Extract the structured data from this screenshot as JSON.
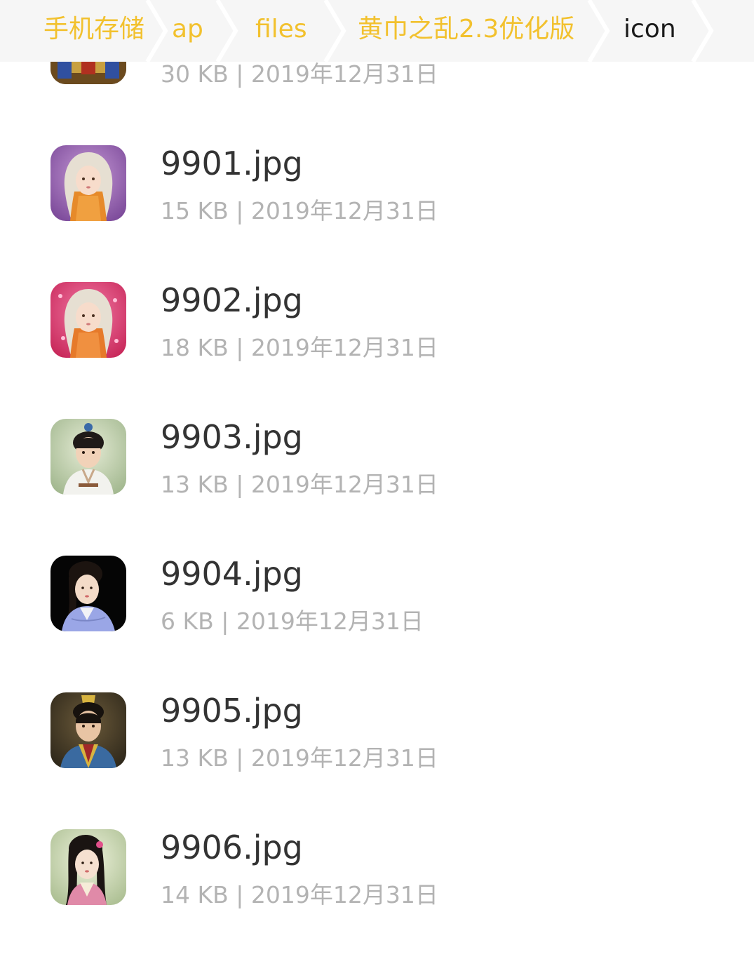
{
  "breadcrumb": {
    "items": [
      {
        "label": "手机存储"
      },
      {
        "label": "ap"
      },
      {
        "label": "files"
      },
      {
        "label": "黄巾之乱2.3优化版"
      },
      {
        "label": "icon"
      }
    ],
    "accent_color": "#f2c12e",
    "current_color": "#1a1a1a"
  },
  "files": [
    {
      "name": "",
      "size": "30 KB",
      "date": "2019年12月31日",
      "meta": "30 KB | 2019年12月31日",
      "thumbnail": "portrait-armored-general"
    },
    {
      "name": "9901.jpg",
      "size": "15 KB",
      "date": "2019年12月31日",
      "meta": "15 KB | 2019年12月31日",
      "thumbnail": "portrait-baby-purple-background"
    },
    {
      "name": "9902.jpg",
      "size": "18 KB",
      "date": "2019年12月31日",
      "meta": "18 KB | 2019年12月31日",
      "thumbnail": "portrait-baby-pink-background"
    },
    {
      "name": "9903.jpg",
      "size": "13 KB",
      "date": "2019年12月31日",
      "meta": "13 KB | 2019年12月31日",
      "thumbnail": "portrait-young-boy"
    },
    {
      "name": "9904.jpg",
      "size": "6 KB",
      "date": "2019年12月31日",
      "meta": "6 KB | 2019年12月31日",
      "thumbnail": "portrait-girl-blue-robe"
    },
    {
      "name": "9905.jpg",
      "size": "13 KB",
      "date": "2019年12月31日",
      "meta": "13 KB | 2019年12月31日",
      "thumbnail": "portrait-young-man-crown"
    },
    {
      "name": "9906.jpg",
      "size": "14 KB",
      "date": "2019年12月31日",
      "meta": "14 KB | 2019年12月31日",
      "thumbnail": "portrait-girl-pink-robe"
    }
  ]
}
